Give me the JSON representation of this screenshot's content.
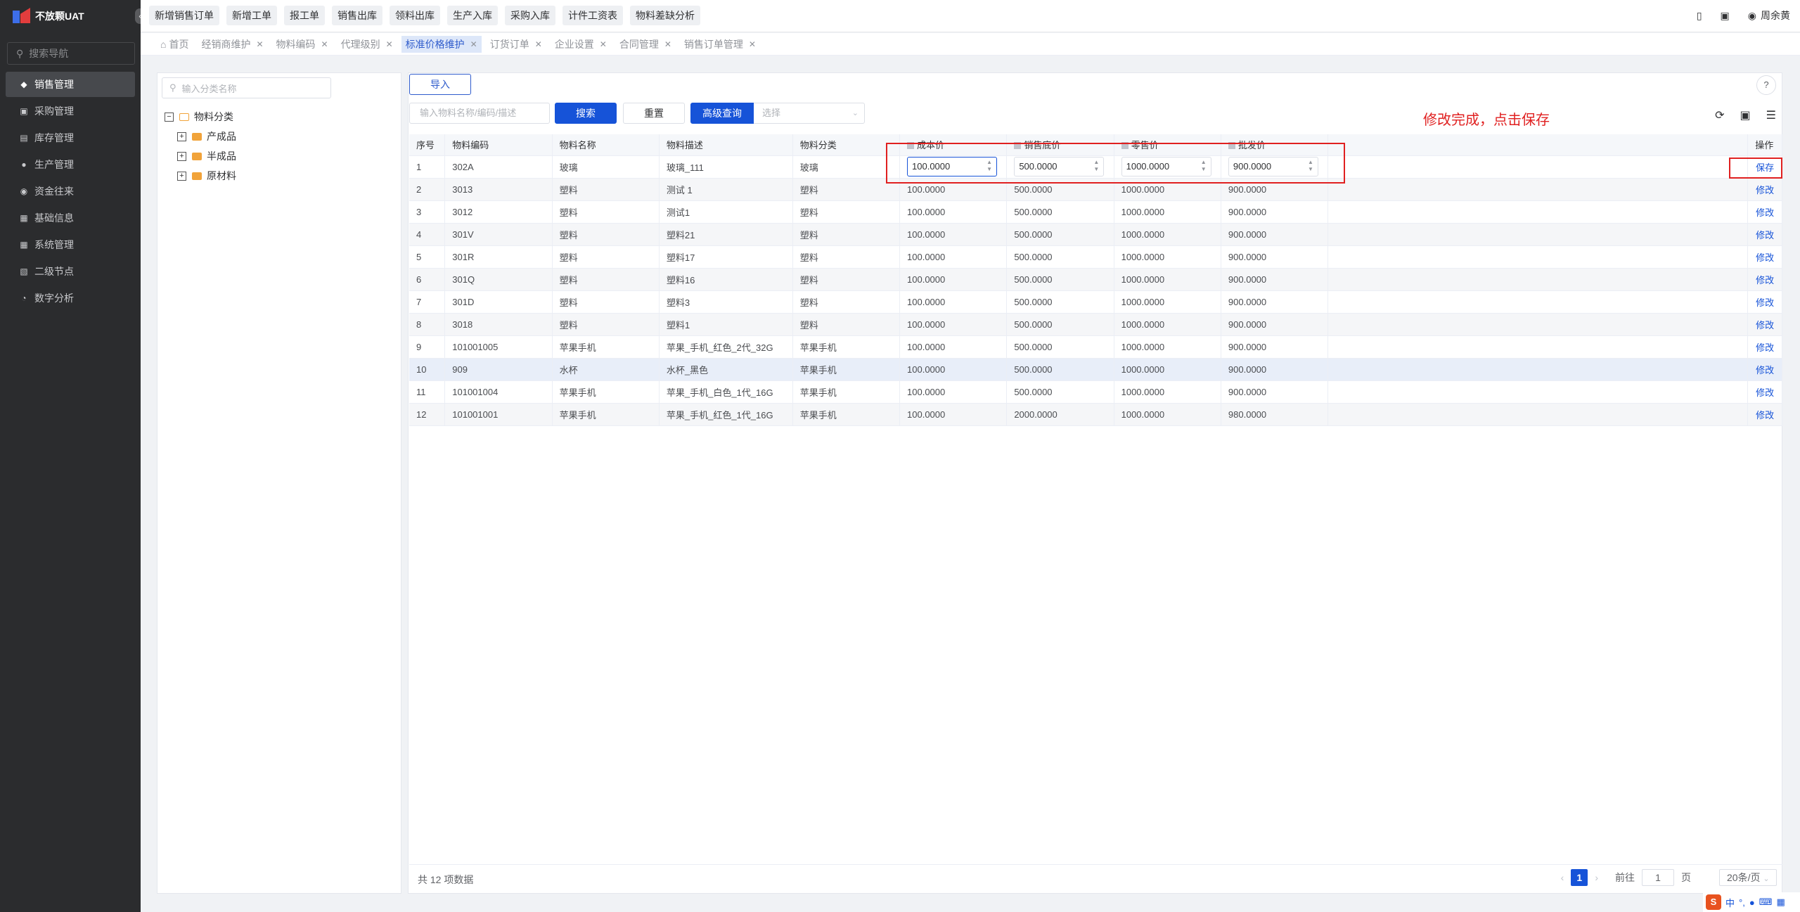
{
  "app": {
    "title": "不放颗UAT"
  },
  "sidebar": {
    "search_placeholder": "搜索导航",
    "items": [
      {
        "label": "销售管理",
        "icon": "tag-icon"
      },
      {
        "label": "采购管理",
        "icon": "cart-icon"
      },
      {
        "label": "库存管理",
        "icon": "inventory-icon"
      },
      {
        "label": "生产管理",
        "icon": "user-icon"
      },
      {
        "label": "资金往来",
        "icon": "coin-icon"
      },
      {
        "label": "基础信息",
        "icon": "grid-icon"
      },
      {
        "label": "系统管理",
        "icon": "grid-icon"
      },
      {
        "label": "二级节点",
        "icon": "doc-icon"
      },
      {
        "label": "数字分析",
        "icon": "pie-icon"
      }
    ]
  },
  "topbar": {
    "quick_links": [
      "新增销售订单",
      "新增工单",
      "报工单",
      "销售出库",
      "领料出库",
      "生产入库",
      "采购入库",
      "计件工资表",
      "物料差缺分析"
    ],
    "user": "周余黄"
  },
  "tabs": [
    "首页",
    "经销商维护",
    "物料编码",
    "代理级别",
    "标准价格维护",
    "订货订单",
    "企业设置",
    "合同管理",
    "销售订单管理"
  ],
  "tree": {
    "search_placeholder": "输入分类名称",
    "root": "物料分类",
    "children": [
      "产成品",
      "半成品",
      "原材料"
    ]
  },
  "toolbar": {
    "import_label": "导入",
    "search_placeholder": "输入物料名称/编码/描述",
    "search_label": "搜索",
    "reset_label": "重置",
    "advanced_label": "高级查询",
    "select_placeholder": "选择"
  },
  "annotation": "修改完成，点击保存",
  "table": {
    "headers": [
      "序号",
      "物料编码",
      "物料名称",
      "物料描述",
      "物料分类",
      "成本价",
      "销售底价",
      "零售价",
      "批发价",
      "",
      "操作"
    ],
    "edit_row": {
      "no": "1",
      "code": "302A",
      "name": "玻璃",
      "desc": "玻璃_111",
      "cat": "玻璃",
      "cost": "100.0000",
      "floor": "500.0000",
      "retail": "1000.0000",
      "wholesale": "900.0000",
      "op": "保存"
    },
    "rows": [
      {
        "no": "2",
        "code": "3013",
        "name": "塑料",
        "desc": "测试 1",
        "cat": "塑料",
        "cost": "100.0000",
        "floor": "500.0000",
        "retail": "1000.0000",
        "wholesale": "900.0000",
        "op": "修改"
      },
      {
        "no": "3",
        "code": "3012",
        "name": "塑料",
        "desc": "测试1",
        "cat": "塑料",
        "cost": "100.0000",
        "floor": "500.0000",
        "retail": "1000.0000",
        "wholesale": "900.0000",
        "op": "修改"
      },
      {
        "no": "4",
        "code": "301V",
        "name": "塑料",
        "desc": "塑料21",
        "cat": "塑料",
        "cost": "100.0000",
        "floor": "500.0000",
        "retail": "1000.0000",
        "wholesale": "900.0000",
        "op": "修改"
      },
      {
        "no": "5",
        "code": "301R",
        "name": "塑料",
        "desc": "塑料17",
        "cat": "塑料",
        "cost": "100.0000",
        "floor": "500.0000",
        "retail": "1000.0000",
        "wholesale": "900.0000",
        "op": "修改"
      },
      {
        "no": "6",
        "code": "301Q",
        "name": "塑料",
        "desc": "塑料16",
        "cat": "塑料",
        "cost": "100.0000",
        "floor": "500.0000",
        "retail": "1000.0000",
        "wholesale": "900.0000",
        "op": "修改"
      },
      {
        "no": "7",
        "code": "301D",
        "name": "塑料",
        "desc": "塑料3",
        "cat": "塑料",
        "cost": "100.0000",
        "floor": "500.0000",
        "retail": "1000.0000",
        "wholesale": "900.0000",
        "op": "修改"
      },
      {
        "no": "8",
        "code": "3018",
        "name": "塑料",
        "desc": "塑料1",
        "cat": "塑料",
        "cost": "100.0000",
        "floor": "500.0000",
        "retail": "1000.0000",
        "wholesale": "900.0000",
        "op": "修改"
      },
      {
        "no": "9",
        "code": "101001005",
        "name": "苹果手机",
        "desc": "苹果_手机_红色_2代_32G",
        "cat": "苹果手机",
        "cost": "100.0000",
        "floor": "500.0000",
        "retail": "1000.0000",
        "wholesale": "900.0000",
        "op": "修改"
      },
      {
        "no": "10",
        "code": "909",
        "name": "水杯",
        "desc": "水杯_黑色",
        "cat": "苹果手机",
        "cost": "100.0000",
        "floor": "500.0000",
        "retail": "1000.0000",
        "wholesale": "900.0000",
        "op": "修改"
      },
      {
        "no": "11",
        "code": "101001004",
        "name": "苹果手机",
        "desc": "苹果_手机_白色_1代_16G",
        "cat": "苹果手机",
        "cost": "100.0000",
        "floor": "500.0000",
        "retail": "1000.0000",
        "wholesale": "900.0000",
        "op": "修改"
      },
      {
        "no": "12",
        "code": "101001001",
        "name": "苹果手机",
        "desc": "苹果_手机_红色_1代_16G",
        "cat": "苹果手机",
        "cost": "100.0000",
        "floor": "2000.0000",
        "retail": "1000.0000",
        "wholesale": "980.0000",
        "op": "修改"
      }
    ]
  },
  "footer": {
    "total": "共 12 项数据",
    "page": "1",
    "goto_label": "前往",
    "goto_value": "1",
    "page_unit": "页",
    "page_size": "20条/页"
  },
  "ime": {
    "logo": "S",
    "label": "中"
  },
  "colors": {
    "primary": "#1653d8",
    "annotation": "#e02020",
    "sidebar": "#2b2c2e"
  }
}
